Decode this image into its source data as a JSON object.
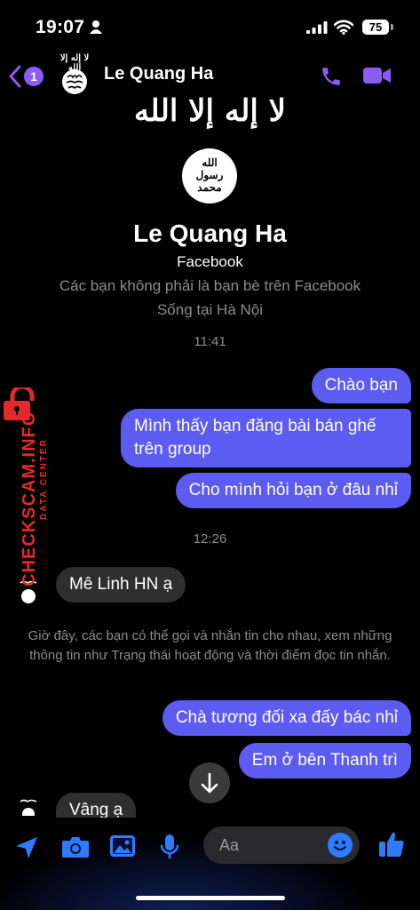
{
  "status_bar": {
    "time": "19:07",
    "battery": "75"
  },
  "header": {
    "unread_count": "1",
    "contact_name": "Le Quang Ha"
  },
  "profile": {
    "flag_text": "لا إله إلا الله",
    "seal_line1": "الله",
    "seal_line2": "رسول",
    "seal_line3": "محمد",
    "name": "Le Quang Ha",
    "platform": "Facebook",
    "relationship": "Các bạn không phải là bạn bè trên Facebook",
    "location": "Sống tại Hà Nội"
  },
  "conversation": {
    "time_1": "11:41",
    "out_1": "Chào bạn",
    "out_2": "Mình thấy bạn đăng bài bán ghế trên group",
    "out_3": "Cho mình hỏi bạn ở đâu nhỉ",
    "time_2": "12:26",
    "in_1": "Mê Linh HN ạ",
    "notice": "Giờ đây, các bạn có thể gọi và nhắn tin cho nhau, xem những thông tin như Trạng thái hoạt động và thời điểm đọc tin nhắn.",
    "out_4": "Chà tương đối xa đấy bác nhỉ",
    "out_5": "Em ở bên Thanh trì",
    "in_2": "Vâng ạ"
  },
  "watermark": {
    "brand": "CHECKSCAM.INFO",
    "tagline": "DATA CENTER"
  },
  "composer": {
    "placeholder": "Aa"
  },
  "colors": {
    "accent": "#8a5cf6",
    "bubble_out": "#5c5cf2",
    "bubble_in": "#2f2f2f",
    "icon_blue": "#2e7bff",
    "watermark": "#e32a2a"
  }
}
